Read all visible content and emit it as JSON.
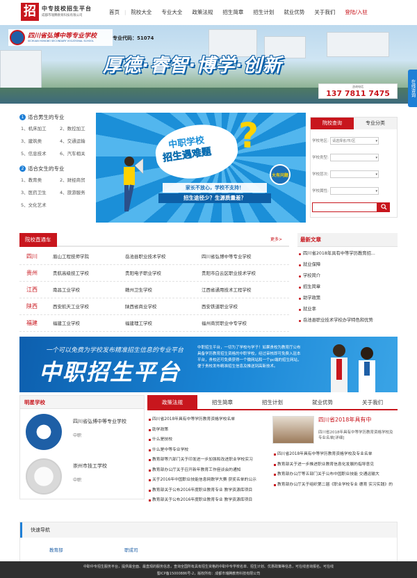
{
  "header": {
    "logo_char": "招",
    "site_title": "中专技校招生平台",
    "site_sub": "成都市瑞腾教育科技有限公司",
    "nav": [
      "首页",
      "院校大全",
      "专业大全",
      "政策法规",
      "招生简章",
      "招生计划",
      "就业优势",
      "关于我们"
    ],
    "login": "登陆/入驻"
  },
  "banner": {
    "school_name": "四川省弘博中等专业学校",
    "school_en": "SICHUAN HONGBO SECONDARY VOCATIONAL SCHOOL",
    "code_label": "专业代码：51074",
    "slogan": "厚德·睿智·博学·创新",
    "hotline_label": "咨询电话",
    "hotline": "137 7811 7475",
    "side_consult": "在线咨询"
  },
  "majors": {
    "male_title": "适合男生的专业",
    "male_items": [
      "机床加工",
      "数控加工",
      "建筑类",
      "交通运输",
      "信息技术",
      "汽车相关"
    ],
    "female_title": "适合女生的专业",
    "female_items": [
      "教育类",
      "财经商贸",
      "医药卫生",
      "旅游服务",
      "文化艺术"
    ]
  },
  "promo": {
    "line1": "中职学校",
    "line2": "招生遇难题",
    "bar1": "家长不放心，学校不支持！",
    "bar2": "招生途径少？生源质量差？",
    "badge": "大有问题"
  },
  "search": {
    "tabs": [
      "院校查询",
      "专业分类"
    ],
    "fields": [
      {
        "label": "学校地区:",
        "value": "请选择省/市/区"
      },
      {
        "label": "学校类型:",
        "value": ""
      },
      {
        "label": "学校层次:",
        "value": ""
      },
      {
        "label": "学校属性:",
        "value": ""
      }
    ]
  },
  "schools": {
    "title": "院校直通车",
    "more": "更多>",
    "rows": [
      {
        "province": "四川",
        "schools": [
          "眉山工程技师学院",
          "岳池县职业技术学校",
          "四川省弘博中等专业学校"
        ]
      },
      {
        "province": "贵州",
        "schools": [
          "贵航高级技工学校",
          "贵阳电子职业学校",
          "贵阳市白云区职业技术学校"
        ]
      },
      {
        "province": "江西",
        "schools": [
          "南昌工业学校",
          "赣州卫生学校",
          "江西省通用技术工程学校"
        ]
      },
      {
        "province": "陕西",
        "schools": [
          "西安航天工业学校",
          "陕西省商业学校",
          "西安铁道职业学校"
        ]
      },
      {
        "province": "福建",
        "schools": [
          "福建工业学校",
          "福建理工学校",
          "福州商贸职业中专学校"
        ]
      }
    ]
  },
  "news": {
    "title": "最新文章",
    "items": [
      "四川省2018年具有中等学历教育招...",
      "就业保障",
      "学校简介",
      "招生简章",
      "助学政策",
      "就业率",
      "岳池县职业技术学校办学特色和优势"
    ]
  },
  "platform": {
    "small": "一个可以免费为学校发布精准招生信息的专业平台",
    "big": "中职招生平台",
    "text": "中职招生平台，一切为了学校与学子！如果贵校为教育厅公布具备学历教育招生资格的中职学校，经过审核即可免费入驻本平台，贵校还可免费获得一个微网站和一个pc端的招生网站，便于贵校发布精准招生信息及推送到高新技术。"
  },
  "stars": {
    "title": "明星学校",
    "items": [
      {
        "name": "四川省弘博中等专业学校",
        "level": "中职"
      },
      {
        "name": "崇州市技工学校",
        "level": "中职"
      }
    ]
  },
  "policy": {
    "tabs": [
      "政策法规",
      "招生简章",
      "招生计划",
      "就业优势",
      "关于我们"
    ],
    "list": [
      "四川省2018年具有中等学历教育资格学校名单",
      "助学政策",
      "什么是技校",
      "什么是中等专业学校",
      "教育部等六部门关于印发进一步加强和改进职业学校实习",
      "教育部办公厅关于召开新年教育工作座谈会的通知",
      "关于2016年中国职业技能信息网数学大赛 获奖名单的公示",
      "教育部关于公布2016年度职业教育专业 教学资源库项目",
      "教育部关于公布2016年度职业教育专业 教学资源库项目"
    ],
    "feature_title": "四川省2018年具有中",
    "feature_desc": "四川省2018年具有中等学历教育资格学校及专业名单[详细]",
    "list2": [
      "四川省2018年具有中等学历教育资格学校及专业名单",
      "教育部关于进一步推进职业教育信息化发展的指导意见",
      "教育部办公厅等五部门关于公布中国职业技能 交通运输大",
      "教育部办公厅关于组织第二届《职业学校专业 德育 实习实践》的"
    ]
  },
  "quick": {
    "title": "快速导航",
    "links": [
      "教育部",
      "职成司"
    ]
  },
  "footer": {
    "line1": "中职中专招生服务平台，提供最全面、最直观的服务信息，查询全国所有具有招生资格的中职中专学校名单、招生计划、优惠政策等信息，可在线咨询报名。可在线",
    "line2": "蜀ICP备15000886号-2，版权所有：成都市瑞腾教育科技有限公司"
  }
}
